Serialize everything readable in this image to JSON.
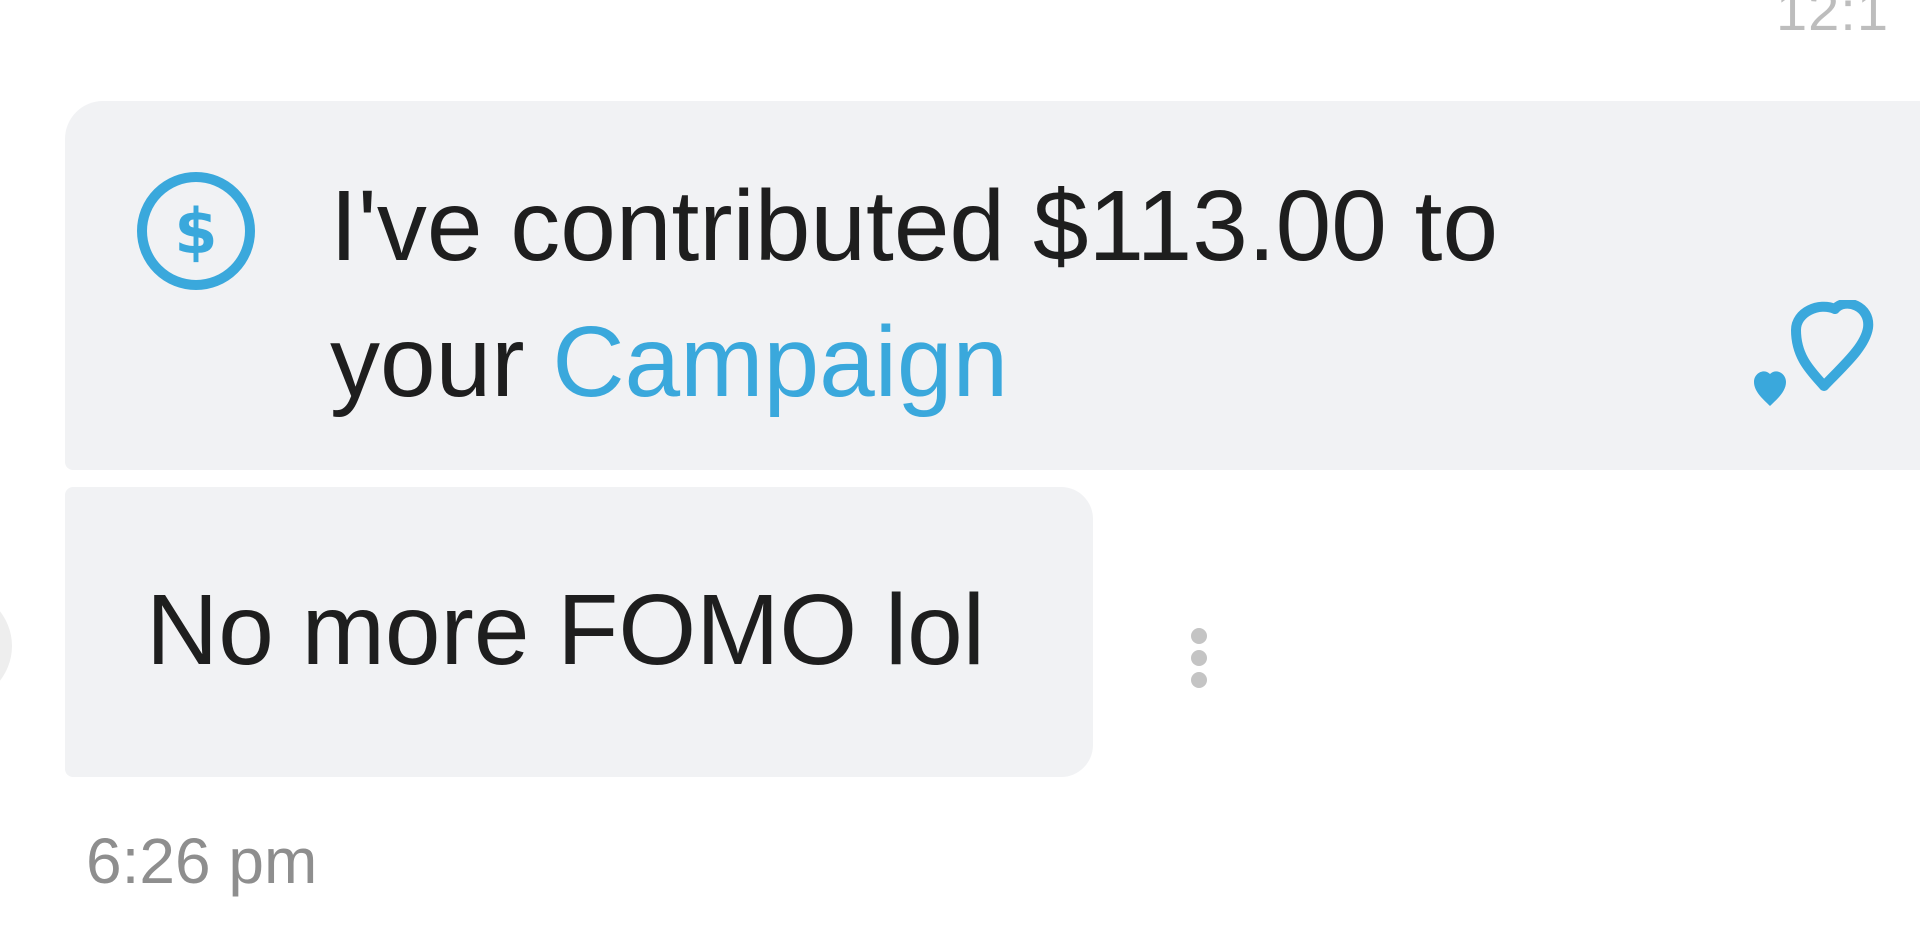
{
  "header": {
    "timestamp": "12:1"
  },
  "contribution_message": {
    "icon": "dollar-circle-icon",
    "text_prefix": "I've contributed $113.00 to your ",
    "link_text": "Campaign",
    "accent_color": "#3aa8dc",
    "reaction_icon": "double-heart-icon"
  },
  "text_message": {
    "text": "No more FOMO lol",
    "options_icon": "more-vertical-icon"
  },
  "footer": {
    "timestamp": "6:26 pm"
  },
  "colors": {
    "bubble_background": "#f1f2f4",
    "text": "#1e1e1e",
    "timestamp": "#8e8e8e"
  }
}
